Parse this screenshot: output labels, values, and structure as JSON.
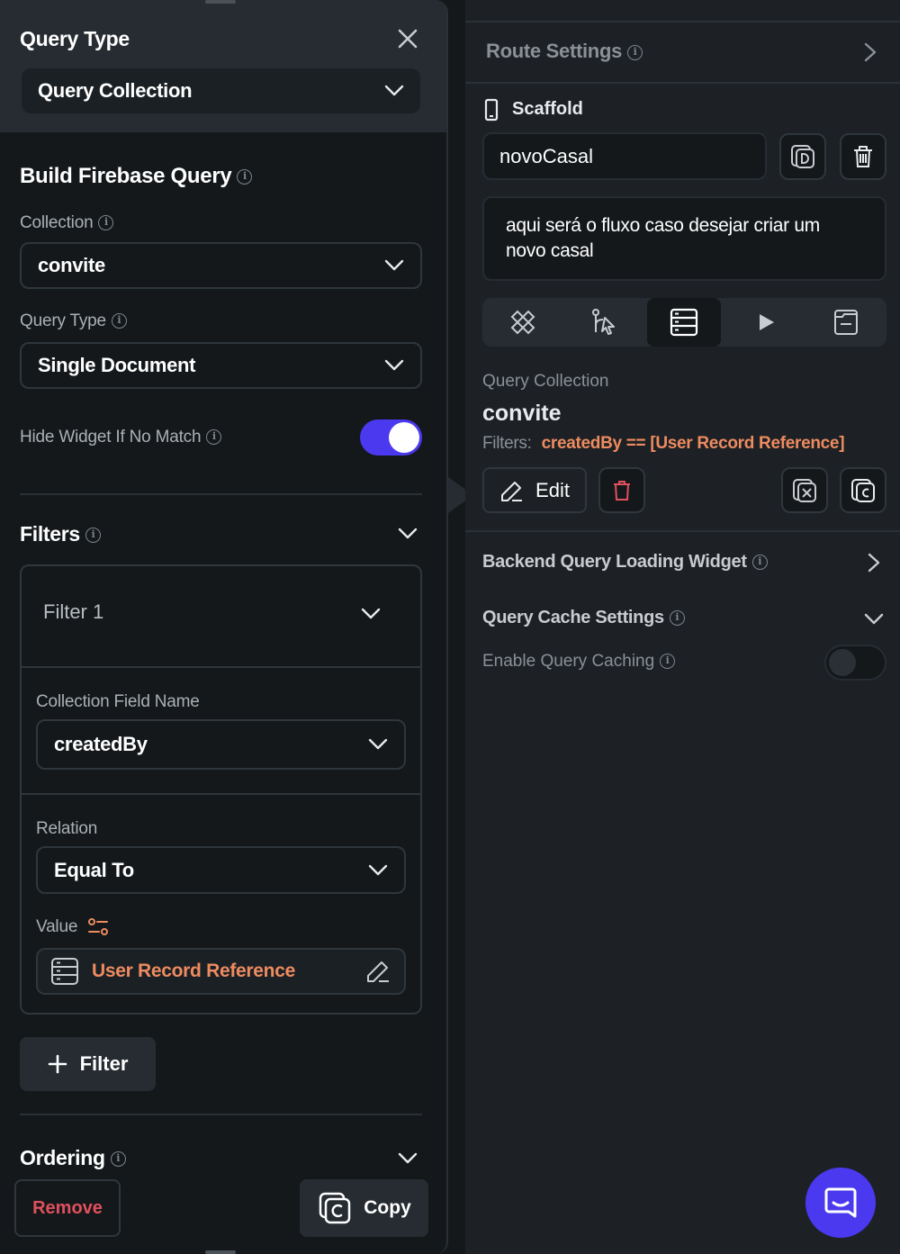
{
  "left": {
    "header": {
      "title": "Query Type",
      "query_type_value": "Query Collection"
    },
    "build": {
      "title": "Build Firebase Query",
      "collection_label": "Collection",
      "collection_value": "convite",
      "query_type_label": "Query Type",
      "query_type_value": "Single Document",
      "hide_widget_label": "Hide Widget If No Match",
      "hide_widget_on": true
    },
    "filters": {
      "title": "Filters",
      "filter_name": "Filter 1",
      "field_label": "Collection Field Name",
      "field_value": "createdBy",
      "relation_label": "Relation",
      "relation_value": "Equal To",
      "value_label": "Value",
      "value_value": "User Record Reference",
      "add_label": "Filter"
    },
    "ordering": {
      "title": "Ordering"
    },
    "footer": {
      "remove_label": "Remove",
      "copy_label": "Copy"
    }
  },
  "right": {
    "route_settings": "Route Settings",
    "scaffold_label": "Scaffold",
    "page_name": "novoCasal",
    "page_description": "aqui será o fluxo caso desejar criar um novo casal",
    "query_label": "Query Collection",
    "query_collection": "convite",
    "filters_label": "Filters:",
    "filters_value": "createdBy == [User Record Reference]",
    "edit_label": "Edit",
    "loading_widget_label": "Backend Query Loading Widget",
    "cache_settings_label": "Query Cache Settings",
    "enable_cache_label": "Enable Query Caching",
    "enable_cache_on": false
  },
  "colors": {
    "accent": "#4b39ef",
    "orange": "#ee8b60",
    "danger": "#e0505d",
    "panel_bg": "#14181b",
    "right_bg": "#1d2125"
  }
}
